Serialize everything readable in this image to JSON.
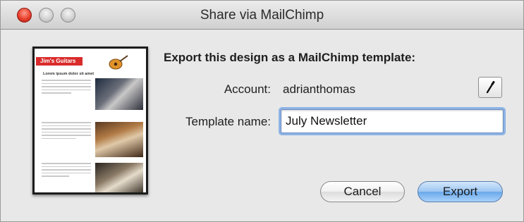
{
  "window": {
    "title": "Share via MailChimp"
  },
  "thumbnail": {
    "banner_text": "Jim's Guitars",
    "heading_text": "Lorem ipsum dolor sit amet"
  },
  "form": {
    "heading": "Export this design as a MailChimp template:",
    "account_label": "Account:",
    "account_value": "adrianthomas",
    "template_name_label": "Template name:",
    "template_name_value": "July Newsletter"
  },
  "buttons": {
    "cancel_label": "Cancel",
    "export_label": "Export",
    "edit_icon": "pencil-icon"
  },
  "colors": {
    "default_button": "#7fb6ee",
    "focus_ring": "#8db3e6",
    "close_button": "#e8402d"
  }
}
